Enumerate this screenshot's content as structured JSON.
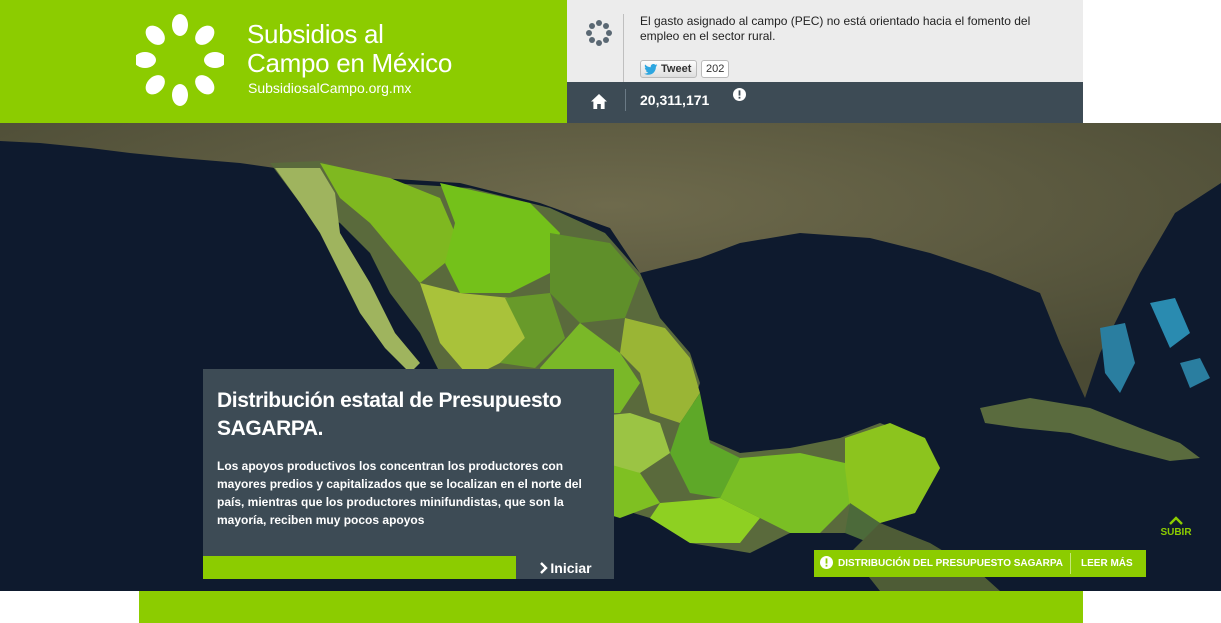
{
  "header": {
    "title_line1": "Subsidios al",
    "title_line2": "Campo en México",
    "url": "SubsidiosalCampo.org.mx",
    "logo_icon": "flower-logo-icon",
    "brand_color": "#8ccc00"
  },
  "news": {
    "text": "El gasto asignado al campo (PEC) no está orientado hacia el fomento del empleo en el sector rural.",
    "tweet_label": "Tweet",
    "tweet_count": "202"
  },
  "stats": {
    "count": "20,311,171",
    "home_icon": "home-icon",
    "info_icon": "info-icon"
  },
  "card": {
    "title": "Distribución estatal de Presupuesto SAGARPA.",
    "body": "Los apoyos productivos los concentran los productores con mayores predios y capitalizados que se localizan en el norte del país, mientras que los productores minifundistas, que son la mayoría, reciben muy pocos apoyos",
    "start_label": "Iniciar"
  },
  "nav": {
    "up_label": "SUBIR"
  },
  "distribution_bar": {
    "label": "DISTRIBUCIÓN DEL PRESUPUESTO SAGARPA",
    "more_label": "LEER MÁS"
  },
  "colors": {
    "dark_panel": "#3d4b55",
    "light_panel": "#ececec"
  }
}
